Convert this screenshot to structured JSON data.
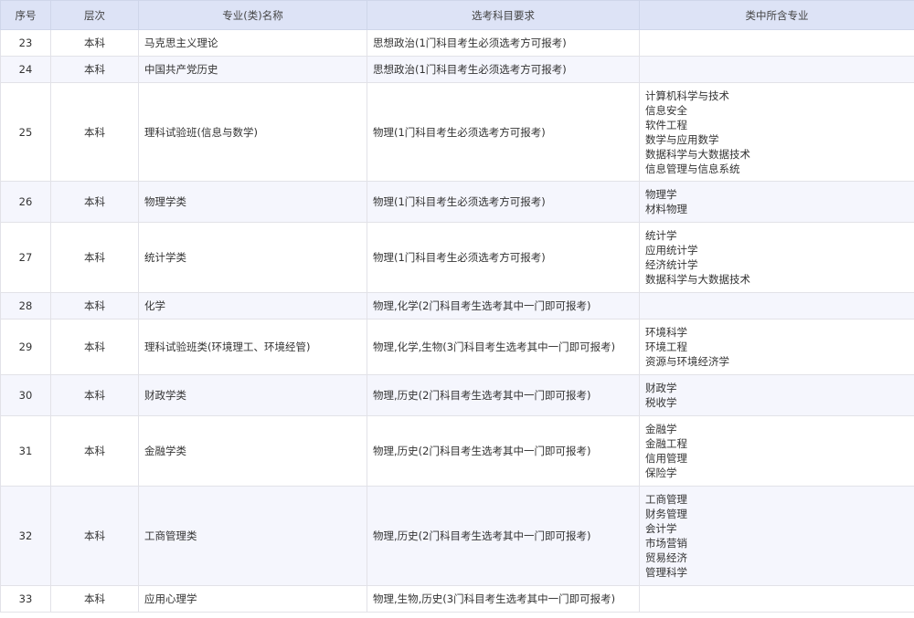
{
  "headers": [
    "序号",
    "层次",
    "专业(类)名称",
    "选考科目要求",
    "类中所含专业"
  ],
  "rows": [
    {
      "no": "23",
      "level": "本科",
      "name": "马克思主义理论",
      "req": "思想政治(1门科目考生必须选考方可报考)",
      "majors": [],
      "h": 29
    },
    {
      "no": "24",
      "level": "本科",
      "name": "中国共产党历史",
      "req": "思想政治(1门科目考生必须选考方可报考)",
      "majors": [],
      "h": 29
    },
    {
      "no": "25",
      "level": "本科",
      "name": "理科试验班(信息与数学)",
      "req": "物理(1门科目考生必须选考方可报考)",
      "majors": [
        "计算机科学与技术",
        "信息安全",
        "软件工程",
        "数学与应用数学",
        "数据科学与大数据技术",
        "信息管理与信息系统"
      ],
      "h": 108
    },
    {
      "no": "26",
      "level": "本科",
      "name": "物理学类",
      "req": "物理(1门科目考生必须选考方可报考)",
      "majors": [
        "物理学",
        "材料物理"
      ],
      "h": 45
    },
    {
      "no": "27",
      "level": "本科",
      "name": "统计学类",
      "req": "物理(1门科目考生必须选考方可报考)",
      "majors": [
        "统计学",
        "应用统计学",
        "经济统计学",
        "数据科学与大数据技术"
      ],
      "h": 77
    },
    {
      "no": "28",
      "level": "本科",
      "name": "化学",
      "req": "物理,化学(2门科目考生选考其中一门即可报考)",
      "majors": [],
      "h": 29
    },
    {
      "no": "29",
      "level": "本科",
      "name": "理科试验班类(环境理工、环境经管)",
      "req": "物理,化学,生物(3门科目考生选考其中一门即可报考)",
      "majors": [
        "环境科学",
        "环境工程",
        "资源与环境经济学"
      ],
      "h": 61
    },
    {
      "no": "30",
      "level": "本科",
      "name": "财政学类",
      "req": "物理,历史(2门科目考生选考其中一门即可报考)",
      "majors": [
        "财政学",
        "税收学"
      ],
      "h": 45
    },
    {
      "no": "31",
      "level": "本科",
      "name": "金融学类",
      "req": "物理,历史(2门科目考生选考其中一门即可报考)",
      "majors": [
        "金融学",
        "金融工程",
        "信用管理",
        "保险学"
      ],
      "h": 77
    },
    {
      "no": "32",
      "level": "本科",
      "name": "工商管理类",
      "req": "物理,历史(2门科目考生选考其中一门即可报考)",
      "majors": [
        "工商管理",
        "财务管理",
        "会计学",
        "市场营销",
        "贸易经济",
        "管理科学"
      ],
      "h": 109
    },
    {
      "no": "33",
      "level": "本科",
      "name": "应用心理学",
      "req": "物理,生物,历史(3门科目考生选考其中一门即可报考)",
      "majors": [],
      "h": 29
    }
  ]
}
